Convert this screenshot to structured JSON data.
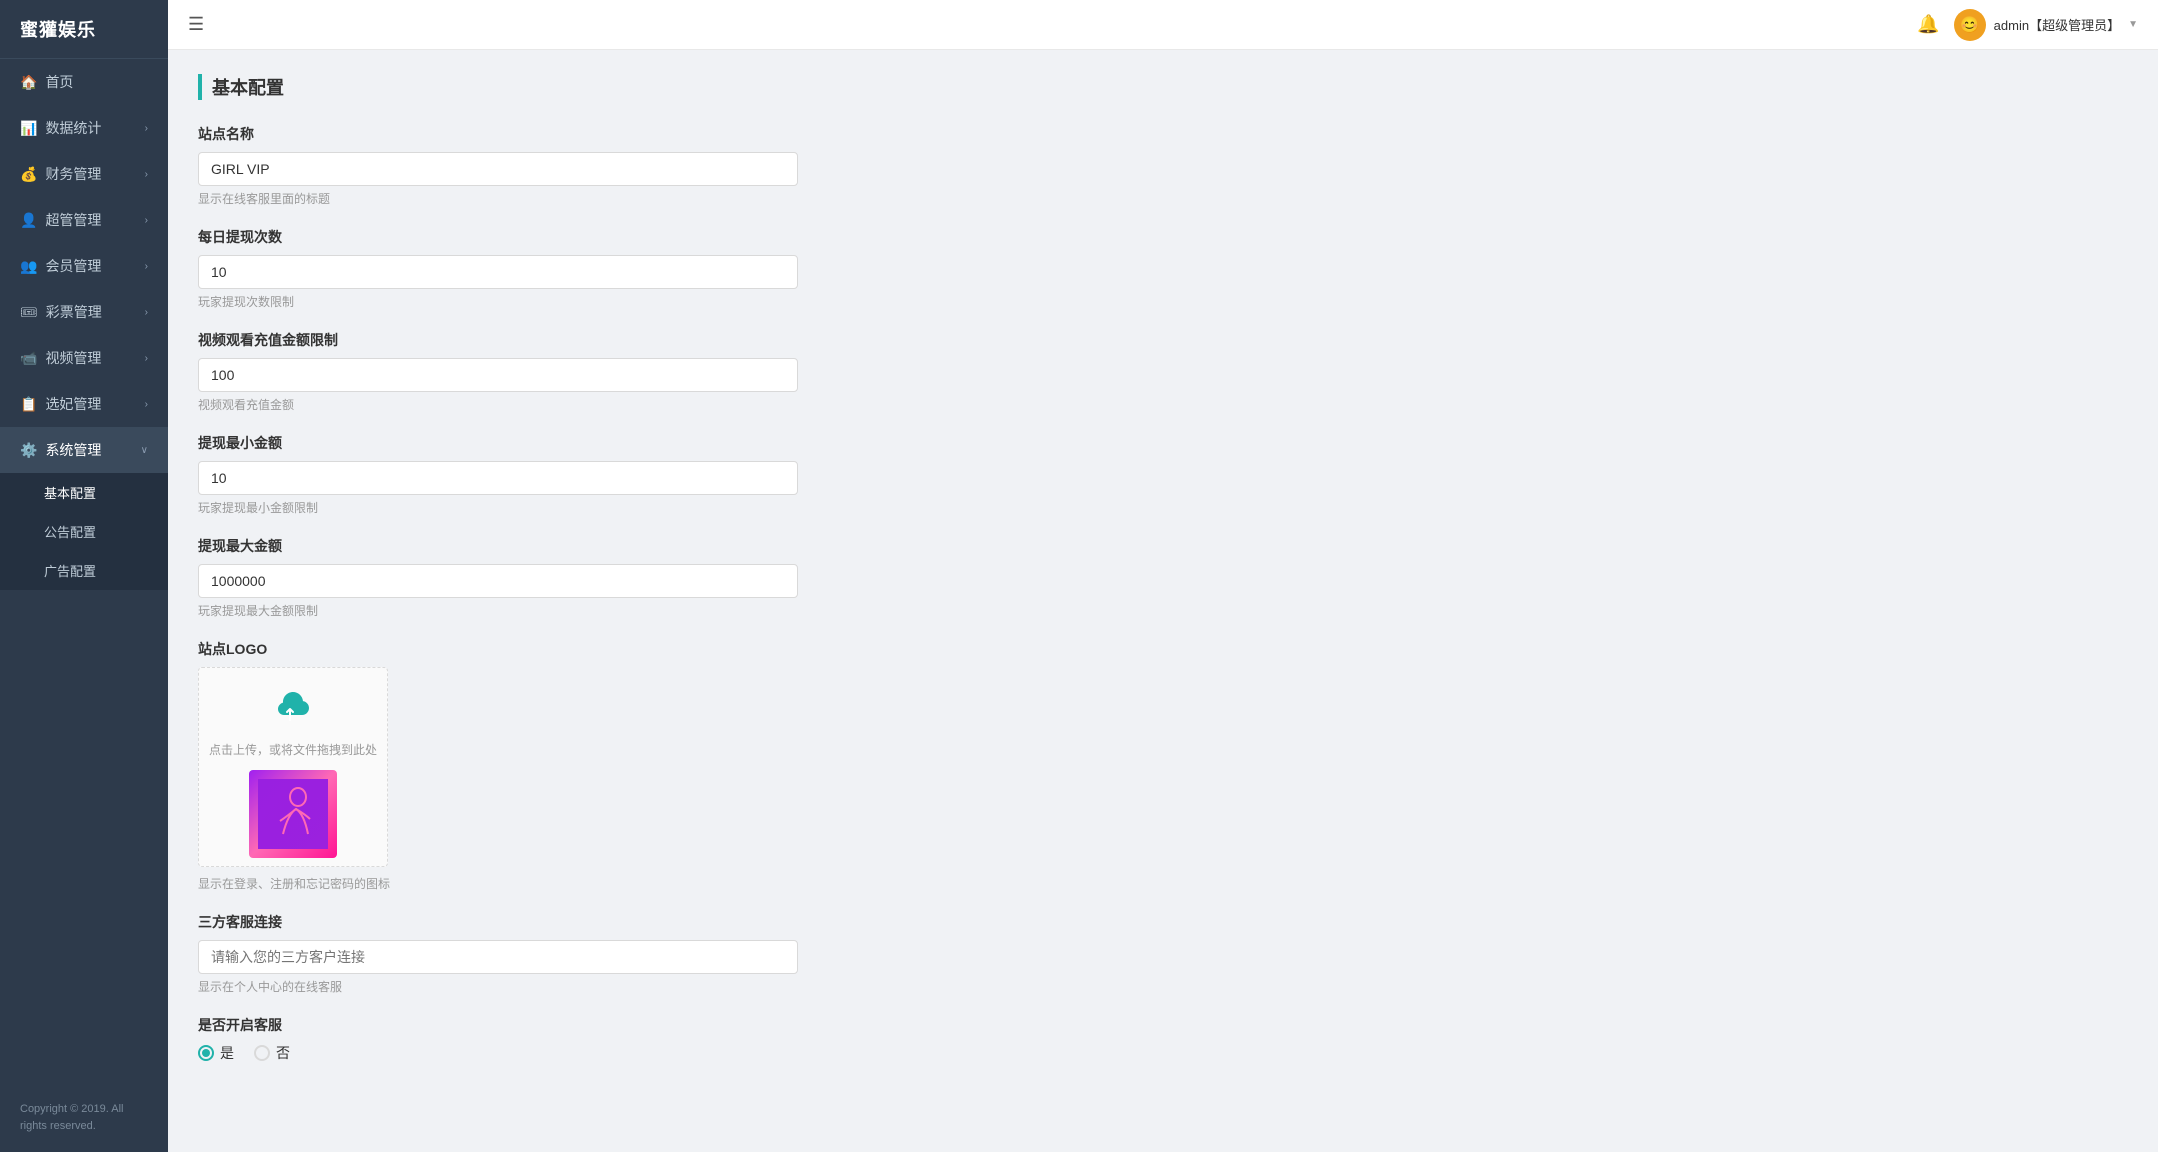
{
  "app": {
    "logo": "蜜獾娱乐",
    "title": "基本配置"
  },
  "header": {
    "admin_label": "admin【超级管理员】",
    "dropdown_arrow": "▼"
  },
  "sidebar": {
    "items": [
      {
        "id": "home",
        "label": "首页",
        "icon": "🏠",
        "hasArrow": false,
        "active": false
      },
      {
        "id": "data",
        "label": "数据统计",
        "icon": "📊",
        "hasArrow": true,
        "active": false
      },
      {
        "id": "finance",
        "label": "财务管理",
        "icon": "💰",
        "hasArrow": true,
        "active": false
      },
      {
        "id": "super",
        "label": "超管管理",
        "icon": "👤",
        "hasArrow": true,
        "active": false
      },
      {
        "id": "member",
        "label": "会员管理",
        "icon": "👥",
        "hasArrow": true,
        "active": false
      },
      {
        "id": "lottery",
        "label": "彩票管理",
        "icon": "🎟",
        "hasArrow": true,
        "active": false
      },
      {
        "id": "video",
        "label": "视频管理",
        "icon": "📹",
        "hasArrow": true,
        "active": false
      },
      {
        "id": "selection",
        "label": "选妃管理",
        "icon": "📋",
        "hasArrow": true,
        "active": false
      },
      {
        "id": "system",
        "label": "系统管理",
        "icon": "⚙️",
        "hasArrow": true,
        "active": true,
        "open": true
      }
    ],
    "submenu_system": [
      {
        "id": "basic",
        "label": "基本配置",
        "active": true
      },
      {
        "id": "notice",
        "label": "公告配置",
        "active": false
      },
      {
        "id": "ads",
        "label": "广告配置",
        "active": false
      }
    ],
    "footer": "Copyright © 2019. All rights reserved."
  },
  "form": {
    "section_title": "基本配置",
    "site_name_label": "站点名称",
    "site_name_value": "GIRL VIP",
    "site_name_hint": "显示在线客服里面的标题",
    "daily_withdraw_label": "每日提现次数",
    "daily_withdraw_value": "10",
    "daily_withdraw_hint": "玩家提现次数限制",
    "video_limit_label": "视频观看充值金额限制",
    "video_limit_value": "100",
    "video_limit_hint": "视频观看充值金额",
    "min_withdraw_label": "提现最小金额",
    "min_withdraw_value": "10",
    "min_withdraw_hint": "玩家提现最小金额限制",
    "max_withdraw_label": "提现最大金额",
    "max_withdraw_value": "1000000",
    "max_withdraw_hint": "玩家提现最大金额限制",
    "logo_label": "站点LOGO",
    "upload_text": "点击上传，或将文件拖拽到此处",
    "logo_hint": "显示在登录、注册和忘记密码的图标",
    "third_service_label": "三方客服连接",
    "third_service_placeholder": "请输入您的三方客户连接",
    "third_service_hint": "显示在个人中心的在线客服",
    "customer_service_label": "是否开启客服",
    "radio_yes": "是",
    "radio_no": "否"
  }
}
